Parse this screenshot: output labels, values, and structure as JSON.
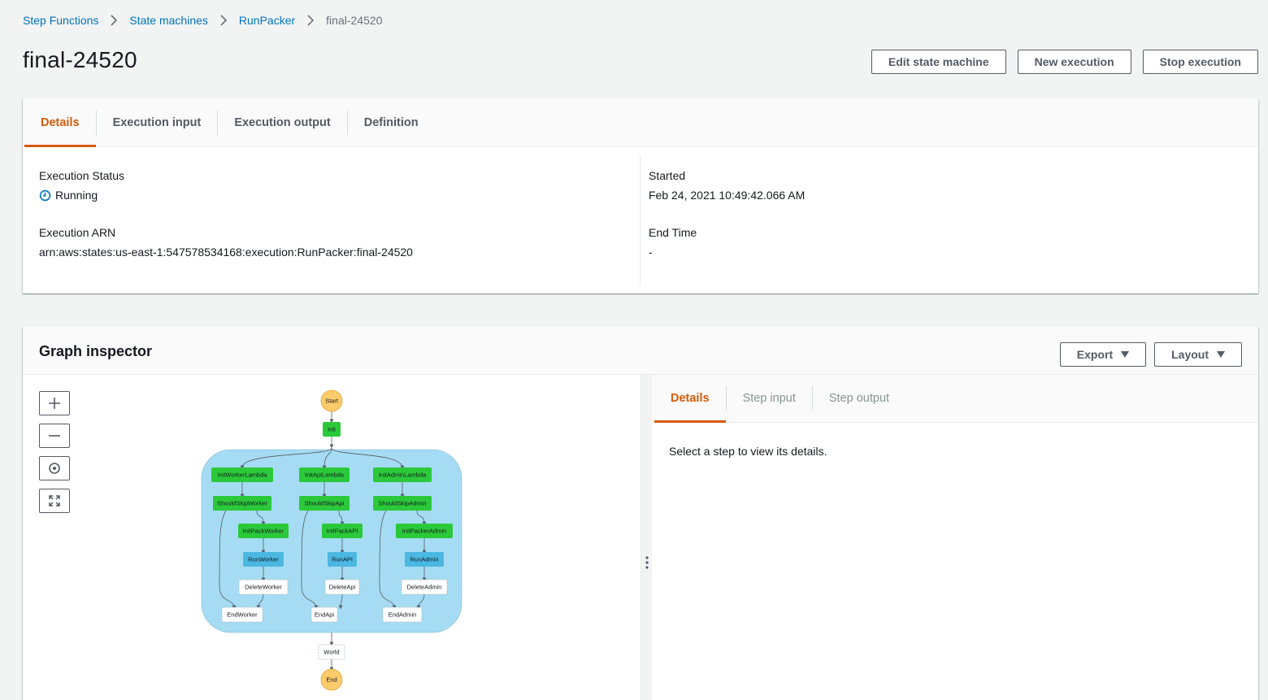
{
  "breadcrumb": {
    "items": [
      "Step Functions",
      "State machines",
      "RunPacker"
    ],
    "current": "final-24520"
  },
  "page": {
    "title": "final-24520"
  },
  "header_actions": {
    "edit": "Edit state machine",
    "new_execution": "New execution",
    "stop_execution": "Stop execution"
  },
  "details_tabs": [
    "Details",
    "Execution input",
    "Execution output",
    "Definition"
  ],
  "details": {
    "status_label": "Execution Status",
    "status_value": "Running",
    "arn_label": "Execution ARN",
    "arn_value": "arn:aws:states:us-east-1:547578534168:execution:RunPacker:final-24520",
    "started_label": "Started",
    "started_value": "Feb 24, 2021 10:49:42.066 AM",
    "end_label": "End Time",
    "end_value": "-"
  },
  "graph_inspector": {
    "title": "Graph inspector",
    "export_label": "Export",
    "layout_label": "Layout"
  },
  "graph": {
    "start": "Start",
    "init": "Init",
    "end": "End",
    "world": "World",
    "branches": [
      {
        "init_lambda": "InitWorkerLambda",
        "should_skip": "ShouldSkipWorker",
        "init_pack": "InitPackWorker",
        "run": "RunWorker",
        "delete": "DeleteWorker",
        "end": "EndWorker"
      },
      {
        "init_lambda": "InitApiLambda",
        "should_skip": "ShouldSkipApi",
        "init_pack": "InitPackAPI",
        "run": "RunAPI",
        "delete": "DeleteApi",
        "end": "EndApi"
      },
      {
        "init_lambda": "InitAdminLambda",
        "should_skip": "ShouldSkipAdmin",
        "init_pack": "InitPackerAdmin",
        "run": "RunAdmin",
        "delete": "DeleteAdmin",
        "end": "EndAdmin"
      }
    ],
    "colors": {
      "succeeded": "#2bc93a",
      "in_progress": "#4bb8e1",
      "not_started": "#ffffff",
      "start_end": "#fccb6b",
      "parallel_bg": "#a5dcf3"
    }
  },
  "step_tabs": [
    "Details",
    "Step input",
    "Step output"
  ],
  "step_details": {
    "empty_message": "Select a step to view its details."
  },
  "colors": {
    "accent": "#d45b07",
    "link": "#0073bb"
  }
}
